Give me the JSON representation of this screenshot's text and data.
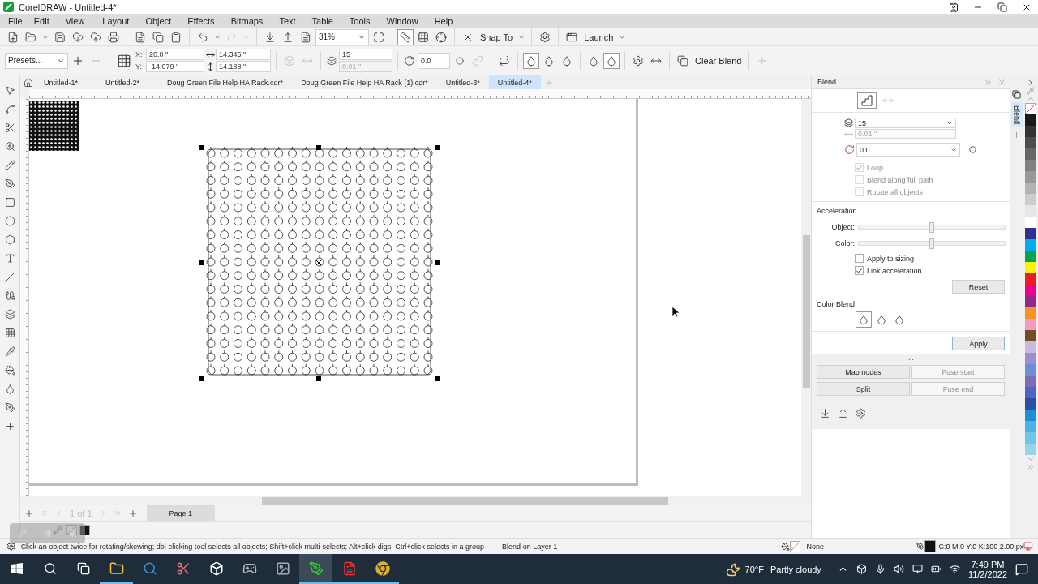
{
  "window": {
    "title": "CorelDRAW - Untitled-4*"
  },
  "menu": [
    "File",
    "Edit",
    "View",
    "Layout",
    "Object",
    "Effects",
    "Bitmaps",
    "Text",
    "Table",
    "Tools",
    "Window",
    "Help"
  ],
  "standard_toolbar": {
    "zoom": "31%",
    "snap": "Snap To",
    "launch": "Launch"
  },
  "property_bar": {
    "presets": "Presets...",
    "x_label": "X:",
    "y_label": "Y:",
    "x": "20.0 \"",
    "y": "-14.079 \"",
    "width": "14.345 \"",
    "height": "14.188 \"",
    "steps": "15",
    "spacing": "0.01 \"",
    "rotation": "0.0",
    "color_modes": [
      {
        "selected": true
      },
      {
        "selected": false
      },
      {
        "selected": false
      }
    ],
    "acceleration_modes": [
      {
        "selected": false
      },
      {
        "selected": true
      }
    ],
    "clear_blend": "Clear Blend"
  },
  "doc_tabs": [
    {
      "label": "Untitled-1*",
      "selected": false
    },
    {
      "label": "Untitled-2*",
      "selected": false
    },
    {
      "label": "Doug Green File Help HA Rack.cdr*",
      "selected": false
    },
    {
      "label": "Doug Green File Help HA Rack (1).cdr*",
      "selected": false
    },
    {
      "label": "Untitled-3*",
      "selected": false
    },
    {
      "label": "Untitled-4*",
      "selected": true
    }
  ],
  "page_nav": {
    "position": "1 of 1",
    "page_tab": "Page 1"
  },
  "docker": {
    "title": "Blend",
    "tab_label": "Blend",
    "steps": "15",
    "spacing": "0.01 \"",
    "rotation": "0.0",
    "path_options": [
      {
        "label": "Loop",
        "checked": true,
        "disabled": true
      },
      {
        "label": "Blend along full path",
        "checked": false,
        "disabled": true
      },
      {
        "label": "Rotate all objects",
        "checked": false,
        "disabled": true
      }
    ],
    "acceleration_title": "Acceleration",
    "sliders": [
      {
        "label": "Object:",
        "level": 0.5
      },
      {
        "label": "Color:",
        "level": 0.5
      }
    ],
    "acceleration_options": [
      {
        "label": "Apply to sizing",
        "checked": false,
        "disabled": false
      },
      {
        "label": "Link acceleration",
        "checked": true,
        "disabled": false
      }
    ],
    "reset": "Reset",
    "color_blend_title": "Color Blend",
    "color_modes": [
      {
        "selected": true
      },
      {
        "selected": false
      },
      {
        "selected": false
      }
    ],
    "apply": "Apply",
    "actions": [
      {
        "label": "Map nodes",
        "disabled": false
      },
      {
        "label": "Fuse start",
        "disabled": true
      },
      {
        "label": "Split",
        "disabled": false
      },
      {
        "label": "Fuse end",
        "disabled": true
      }
    ]
  },
  "palette": [
    {
      "color": "#1a1a1a"
    },
    {
      "color": "#333333"
    },
    {
      "color": "#4d4d4d"
    },
    {
      "color": "#666666"
    },
    {
      "color": "#808080"
    },
    {
      "color": "#999999"
    },
    {
      "color": "#b3b3b3"
    },
    {
      "color": "#cccccc"
    },
    {
      "color": "#e6e6e6"
    },
    {
      "color": "#ffffff"
    },
    {
      "color": "#2e3192"
    },
    {
      "color": "#00aeef"
    },
    {
      "color": "#00a651"
    },
    {
      "color": "#fff200"
    },
    {
      "color": "#ed1c24"
    },
    {
      "color": "#ec008c"
    },
    {
      "color": "#92278f"
    },
    {
      "color": "#f7941d"
    },
    {
      "color": "#f49ac1"
    },
    {
      "color": "#754c24"
    },
    {
      "color": "#c7b9e0"
    },
    {
      "color": "#9b8fcf"
    },
    {
      "color": "#6b8fd6"
    },
    {
      "color": "#7e6bb3"
    },
    {
      "color": "#4a67c4"
    },
    {
      "color": "#2c4fa8"
    },
    {
      "color": "#1f8fd8"
    },
    {
      "color": "#4ab3e8"
    },
    {
      "color": "#6fc6e8"
    },
    {
      "color": "#9ad2e6"
    }
  ],
  "status_bar": {
    "hint": "Click an object twice for rotating/skewing; dbl-clicking tool selects all objects; Shift+click multi-selects; Alt+click digs; Ctrl+click selects in a group",
    "layer": "Blend on Layer 1",
    "fill": "None",
    "outline": "C:0 M:0 Y:0 K:100  2.00 px"
  },
  "taskbar": {
    "apps": [
      {
        "running": true,
        "active": false
      },
      {
        "running": false,
        "active": false
      },
      {
        "running": false,
        "active": false
      },
      {
        "running": false,
        "active": false
      },
      {
        "running": false,
        "active": false
      },
      {
        "running": false,
        "active": false
      },
      {
        "running": true,
        "active": true
      },
      {
        "running": true,
        "active": false
      },
      {
        "running": true,
        "active": false
      }
    ],
    "temperature": "70°F",
    "weather": "Partly cloudy",
    "time": "7:49 PM",
    "date": "11/2/2022"
  }
}
